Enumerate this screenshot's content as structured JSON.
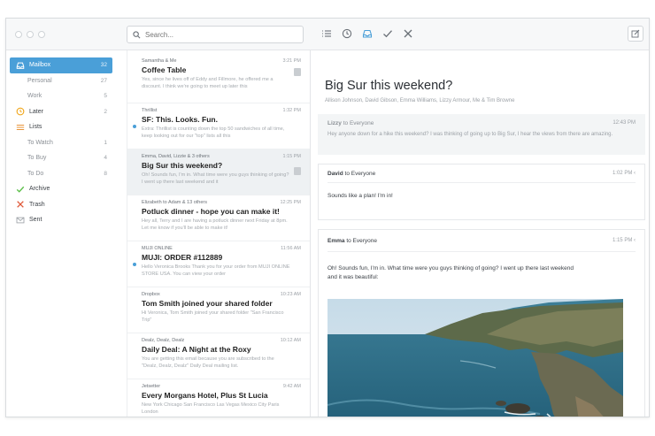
{
  "toolbar": {
    "search_placeholder": "Search..."
  },
  "sidebar": {
    "items": [
      {
        "label": "Mailbox",
        "count": "32",
        "icon": "inbox-icon",
        "active": true,
        "sub": false
      },
      {
        "label": "Personal",
        "count": "27",
        "sub": true
      },
      {
        "label": "Work",
        "count": "5",
        "sub": true
      },
      {
        "label": "Later",
        "count": "2",
        "icon": "clock-icon",
        "sub": false
      },
      {
        "label": "Lists",
        "count": "",
        "icon": "lists-icon",
        "sub": false
      },
      {
        "label": "To Watch",
        "count": "1",
        "sub": true
      },
      {
        "label": "To Buy",
        "count": "4",
        "sub": true
      },
      {
        "label": "To Do",
        "count": "8",
        "sub": true
      },
      {
        "label": "Archive",
        "count": "",
        "icon": "checkmark-icon",
        "sub": false
      },
      {
        "label": "Trash",
        "count": "",
        "icon": "x-icon",
        "sub": false
      },
      {
        "label": "Sent",
        "count": "",
        "icon": "sent-icon",
        "sub": false
      }
    ]
  },
  "messages": [
    {
      "from": "Samantha & Me",
      "time": "3:21 PM",
      "subject": "Coffee Table",
      "preview": "Yes, since he lives off of Eddy and Fillmore, he offered me a discount. I think we're going to meet up later this"
    },
    {
      "from": "Thrillist",
      "time": "1:32 PM",
      "subject": "SF: This. Looks. Fun.",
      "preview": "Extra: Thrillist is counting down the top 50 sandwiches of all time, keep looking out for our \"top\" lists all this"
    },
    {
      "from": "Emma, David, Lizzie & 3 others",
      "time": "1:15 PM",
      "subject": "Big Sur this weekend?",
      "preview": "Oh! Sounds fun, I'm in. What time were you guys thinking of going? I went up there last weekend and it"
    },
    {
      "from": "Elizabeth to Adam & 13 others",
      "time": "12:25 PM",
      "subject": "Potluck dinner - hope you can make it!",
      "preview": "Hey all, Terry and I are having a potluck dinner next Friday at 8pm. Let me know if you'll be able to make it!"
    },
    {
      "from": "MUJI ONLINE",
      "time": "11:56 AM",
      "subject": "MUJI: ORDER #112889",
      "preview": "Hello Veronica Brooks Thank you for your order from MUJI ONLINE STORE USA. You can view your order"
    },
    {
      "from": "Dropbox",
      "time": "10:23 AM",
      "subject": "Tom Smith joined your shared folder",
      "preview": "Hi Veronica, Tom Smith joined your shared folder \"San Francisco Trip\""
    },
    {
      "from": "Dealz, Dealz, Dealz",
      "time": "10:12 AM",
      "subject": "Daily Deal: A Night at the Roxy",
      "preview": "You are getting this email because you are subscribed to the \"Dealz, Dealz, Dealz\" Daily Deal mailing list."
    },
    {
      "from": "Jetsetter",
      "time": "9:42 AM",
      "subject": "Every Morgans Hotel, Plus St Lucia",
      "preview": "New York Chicago San Francisco Las Vegas Mexico City Paris London"
    }
  ],
  "thread": {
    "title": "Big Sur this weekend?",
    "participants": "Allison Johnson, David Gibson, Emma Williams, Lizzy Armour, Me & Tim Browne",
    "cards": [
      {
        "sender": "Lizzy",
        "to": "to Everyone",
        "time": "12:43 PM",
        "body": "Hey anyone down for a hike this weekend? I was thinking of going up to Big Sur, I hear the views from there are amazing."
      },
      {
        "sender": "David",
        "to": "to Everyone",
        "time": "1:02 PM",
        "body": "Sounds like a plan! I'm in!"
      },
      {
        "sender": "Emma",
        "to": "to Everyone",
        "time": "1:15 PM",
        "body": "Oh! Sounds fun, I'm in. What time were you guys thinking of going? I went up there last weekend and it was beautiful:"
      }
    ]
  },
  "colors": {
    "accent": "#4a9fd8",
    "later": "#f0a61a",
    "archive": "#5cbf4a",
    "trash": "#e05a3a"
  }
}
